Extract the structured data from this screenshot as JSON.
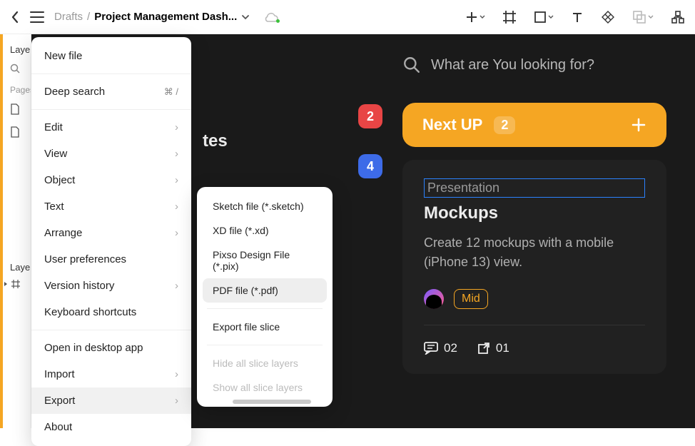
{
  "topbar": {
    "breadcrumb_parent": "Drafts",
    "breadcrumb_current": "Project Management Dash..."
  },
  "sidebar": {
    "tab_layers": "Layers",
    "section_pages": "Pages",
    "section_layers": "Layers"
  },
  "menu": {
    "new_file": "New file",
    "deep_search": "Deep search",
    "deep_search_shortcut": "⌘ /",
    "edit": "Edit",
    "view": "View",
    "object": "Object",
    "text": "Text",
    "arrange": "Arrange",
    "user_preferences": "User preferences",
    "version_history": "Version history",
    "keyboard_shortcuts": "Keyboard shortcuts",
    "open_desktop": "Open in desktop app",
    "import": "Import",
    "export": "Export",
    "about": "About"
  },
  "export_menu": {
    "sketch": "Sketch file (*.sketch)",
    "xd": "XD file (*.xd)",
    "pixso": "Pixso Design File (*.pix)",
    "pdf": "PDF file (*.pdf)",
    "export_slice": "Export file slice",
    "hide_slices": "Hide all slice layers",
    "show_slices": "Show all slice layers"
  },
  "canvas": {
    "notes_label_suffix": "tes",
    "badge_red": "2",
    "badge_blue": "4",
    "search_placeholder": "What are You looking for?",
    "nextup": {
      "label": "Next UP",
      "count": "2"
    },
    "task": {
      "tag": "Presentation",
      "title": "Mockups",
      "desc": "Create 12 mockups with a mobile (iPhone 13) view.",
      "priority": "Mid",
      "comments": "02",
      "attachments": "01"
    }
  }
}
